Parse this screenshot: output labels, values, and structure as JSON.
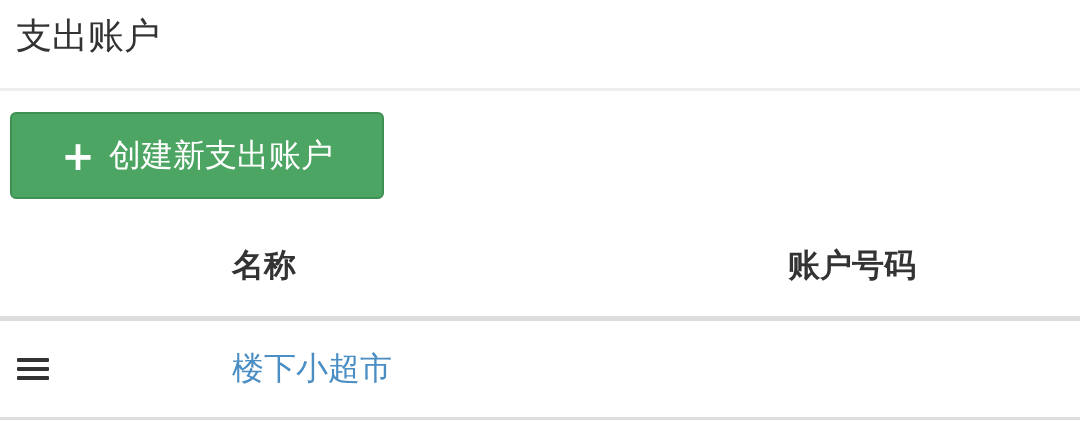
{
  "title": "支出账户",
  "create_button": {
    "icon": "+",
    "label": "创建新支出账户"
  },
  "table": {
    "columns": [
      "名称",
      "账户号码"
    ],
    "rows": [
      {
        "name": "楼下小超市"
      }
    ]
  }
}
